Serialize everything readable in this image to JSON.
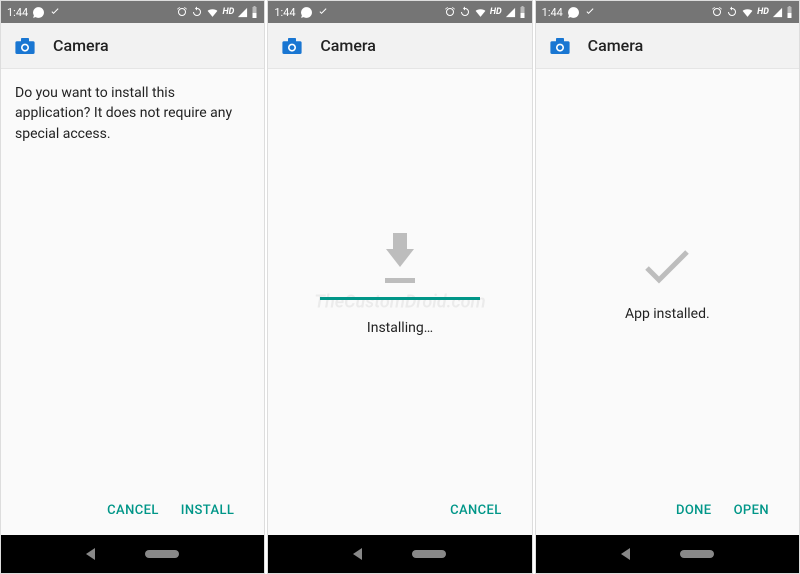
{
  "status": {
    "time": "1:44",
    "hd": "HD"
  },
  "app": {
    "title": "Camera"
  },
  "screen1": {
    "prompt": "Do you want to install this application? It does not require any special access.",
    "cancel": "CANCEL",
    "install": "INSTALL"
  },
  "screen2": {
    "status": "Installing…",
    "cancel": "CANCEL"
  },
  "screen3": {
    "status": "App installed.",
    "done": "DONE",
    "open": "OPEN"
  },
  "watermark": "TheCustomDroid.com"
}
